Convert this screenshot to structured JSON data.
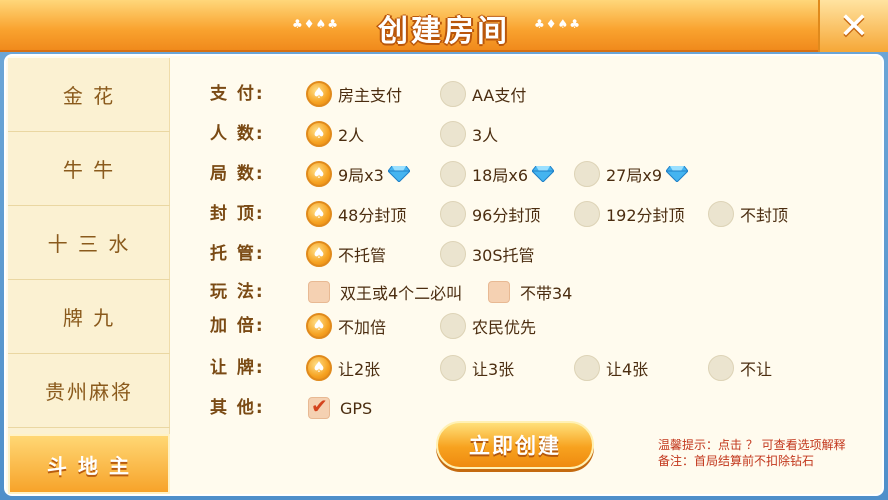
{
  "header": {
    "title": "创建房间",
    "suits_left": "♣♦♠♣",
    "suits_right": "♣♦♠♣"
  },
  "sidebar": {
    "items": [
      {
        "label": "金    花"
      },
      {
        "label": "牛    牛"
      },
      {
        "label": "十 三 水"
      },
      {
        "label": "牌    九"
      },
      {
        "label": "贵州麻将"
      },
      {
        "label": "斗 地 主",
        "selected": true
      }
    ]
  },
  "settings": {
    "pay": {
      "label": "支    付:",
      "options": [
        "房主支付",
        "AA支付"
      ],
      "selected": 0
    },
    "players": {
      "label": "人    数:",
      "options": [
        "2人",
        "3人"
      ],
      "selected": 0
    },
    "rounds": {
      "label": "局    数:",
      "options": [
        "9局x3",
        "18局x6",
        "27局x9"
      ],
      "selected": 0
    },
    "cap": {
      "label": "封    顶:",
      "options": [
        "48分封顶",
        "96分封顶",
        "192分封顶",
        "不封顶"
      ],
      "selected": 0
    },
    "trustee": {
      "label": "托    管:",
      "options": [
        "不托管",
        "30S托管"
      ],
      "selected": 0
    },
    "play": {
      "label": "玩    法:",
      "options": [
        "双王或4个二必叫",
        "不带34"
      ],
      "checked": [
        false,
        false
      ]
    },
    "double": {
      "label": "加    倍:",
      "options": [
        "不加倍",
        "农民优先"
      ],
      "selected": 0
    },
    "concede": {
      "label": "让    牌:",
      "options": [
        "让2张",
        "让3张",
        "让4张",
        "不让"
      ],
      "selected": 0
    },
    "other": {
      "label": "其    他:",
      "options": [
        "GPS"
      ],
      "checked": [
        true
      ]
    }
  },
  "actions": {
    "create_label": "立即创建"
  },
  "tips": {
    "line1": "温馨提示：点击 ？ 可查看选项解释",
    "line2": "备注：首局结算前不扣除钻石"
  },
  "colors": {
    "accent": "#f7a21f",
    "label": "#7a4a14",
    "tip": "#c2361b",
    "diamond": "#3fa8e8"
  }
}
